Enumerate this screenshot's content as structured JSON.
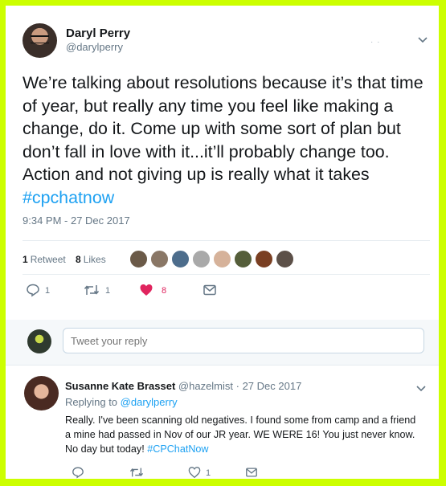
{
  "tweet": {
    "author_name": "Daryl Perry",
    "author_handle": "@darylperry",
    "text": "We’re talking about resolutions because it’s that time of  year, but really any time you feel like making a change, do it. Come up with some sort of plan but don’t fall in love with it...it’ll probably change too. Action and not giving up is really what it takes ",
    "hashtag": "#cpchatnow",
    "timestamp": "9:34 PM - 27 Dec 2017",
    "stats": {
      "retweets_count": "1",
      "retweets_label": "Retweet",
      "likes_count": "8",
      "likes_label": "Likes"
    },
    "actions": {
      "reply_count": "1",
      "retweet_count": "1",
      "like_count": "8"
    }
  },
  "reply_box": {
    "placeholder": "Tweet your reply"
  },
  "reply": {
    "author_name": "Susanne Kate Brasset",
    "author_handle": "@hazelmist",
    "separator": " · ",
    "date": "27 Dec 2017",
    "replying_label": "Replying to ",
    "replying_to": "@darylperry",
    "text": "Really. I've been scanning old negatives. I found some from camp and a friend a mine had passed in Nov of our JR year. WE WERE 16! You just never know. No day but today! ",
    "hashtag": "#CPChatNow",
    "actions": {
      "like_count": "1"
    }
  },
  "colors": {
    "accent": "#1da1f2",
    "like": "#e0245e",
    "muted": "#657786",
    "border": "#ccff00"
  }
}
